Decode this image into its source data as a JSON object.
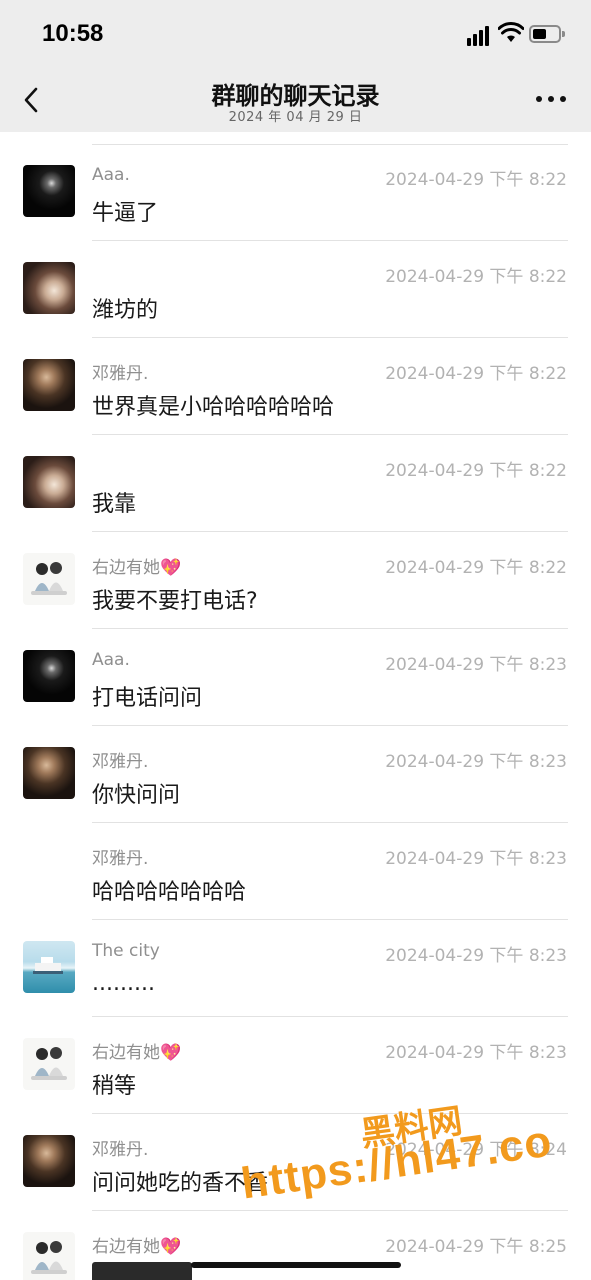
{
  "status_bar": {
    "time": "10:58"
  },
  "header": {
    "title": "群聊的聊天记录",
    "subtitle": "2024 年 04 月 29 日"
  },
  "messages": [
    {
      "sender": "Aaa.",
      "time": "2024-04-29 下午 8:22",
      "text": "牛逼了",
      "avatar": "dark-portrait"
    },
    {
      "sender": "",
      "time": "2024-04-29 下午 8:22",
      "text": "潍坊的",
      "avatar": "girl-selfie"
    },
    {
      "sender": "邓雅丹.",
      "time": "2024-04-29 下午 8:22",
      "text": "世界真是小哈哈哈哈哈哈",
      "avatar": "girl-portrait"
    },
    {
      "sender": "",
      "time": "2024-04-29 下午 8:22",
      "text": "我靠",
      "avatar": "girl-selfie"
    },
    {
      "sender": "右边有她💖",
      "time": "2024-04-29 下午 8:22",
      "text": "我要不要打电话?",
      "avatar": "cartoon-couple"
    },
    {
      "sender": "Aaa.",
      "time": "2024-04-29 下午 8:23",
      "text": "打电话问问",
      "avatar": "dark-portrait"
    },
    {
      "sender": "邓雅丹.",
      "time": "2024-04-29 下午 8:23",
      "text": "你快问问",
      "avatar": "girl-portrait"
    },
    {
      "sender": "邓雅丹.",
      "time": "2024-04-29 下午 8:23",
      "text": "哈哈哈哈哈哈哈",
      "avatar": ""
    },
    {
      "sender": "The city",
      "time": "2024-04-29 下午 8:23",
      "text": ".........",
      "avatar": "ship-photo"
    },
    {
      "sender": "右边有她💖",
      "time": "2024-04-29 下午 8:23",
      "text": "稍等",
      "avatar": "cartoon-couple"
    },
    {
      "sender": "邓雅丹.",
      "time": "2024-04-29 下午 8:24",
      "text": "问问她吃的香不香",
      "avatar": "girl-portrait"
    },
    {
      "sender": "右边有她💖",
      "time": "2024-04-29 下午 8:25",
      "text": "",
      "avatar": "cartoon-couple"
    }
  ],
  "watermark": {
    "top": "黑料网",
    "url": "https://hl47.co"
  }
}
